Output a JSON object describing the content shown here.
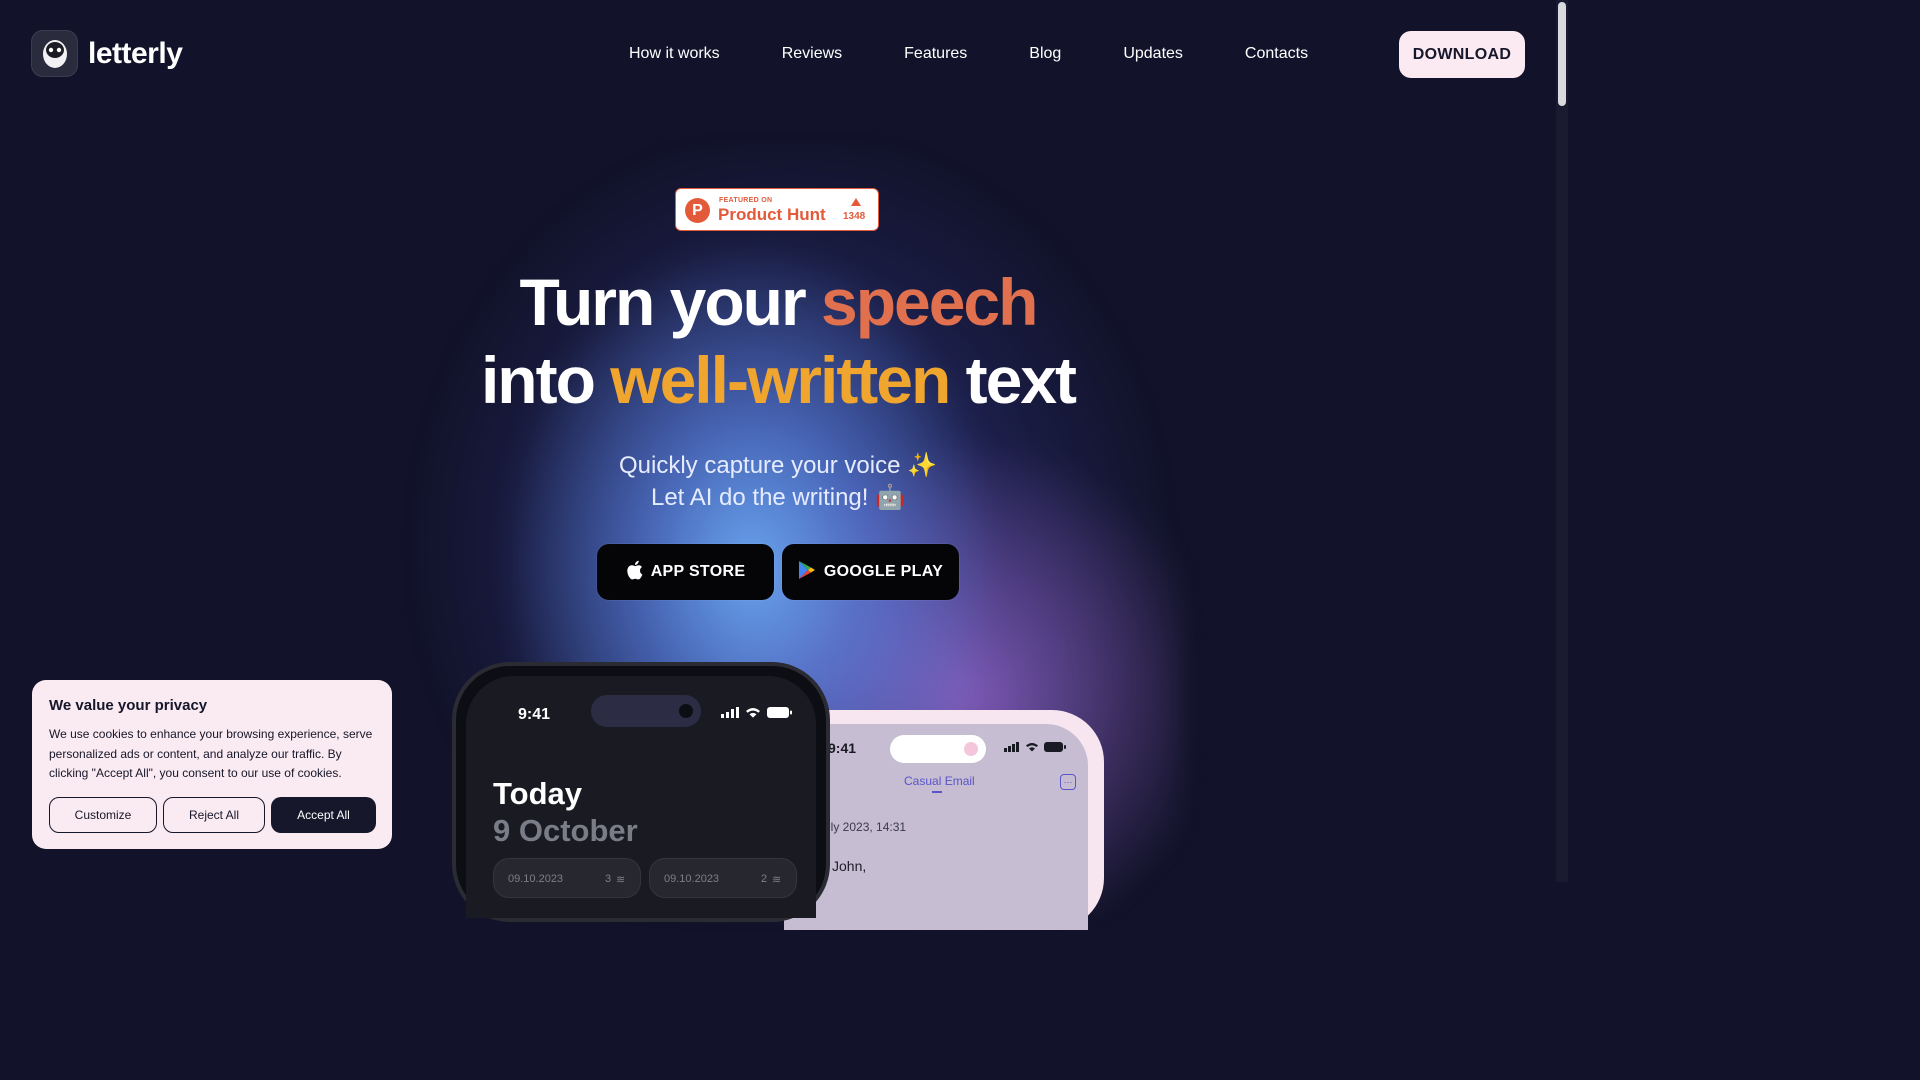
{
  "header": {
    "logo_text": "letterly",
    "nav": [
      "How it works",
      "Reviews",
      "Features",
      "Blog",
      "Updates",
      "Contacts"
    ],
    "download_label": "DOWNLOAD"
  },
  "product_hunt": {
    "featured": "FEATURED ON",
    "name": "Product Hunt",
    "votes": "1348"
  },
  "hero": {
    "line1_a": "Turn your ",
    "line1_b": "speech",
    "line2_a": "into ",
    "line2_b": "well-written",
    "line2_c": " text",
    "sub1": "Quickly capture your voice ✨",
    "sub2": "Let AI do the writing! 🤖",
    "appstore_label": "APP STORE",
    "gplay_label": "GOOGLE PLAY"
  },
  "phone_dark": {
    "time": "9:41",
    "title": "Today",
    "date": "9 October",
    "cards": [
      {
        "date": "09.10.2023",
        "count": "3"
      },
      {
        "date": "09.10.2023",
        "count": "2"
      }
    ]
  },
  "phone_light": {
    "time": "9:41",
    "tab": "Casual Email",
    "date": "uly 2023, 14:31",
    "greeting": "John,"
  },
  "cookie": {
    "title": "We value your privacy",
    "text": "We use cookies to enhance your browsing experience, serve personalized ads or content, and analyze our traffic. By clicking \"Accept All\", you consent to our use of cookies.",
    "customize": "Customize",
    "reject": "Reject All",
    "accept": "Accept All"
  },
  "colors": {
    "background": "#12132a",
    "speech": "#e0704e",
    "well_written": "#f0a52e",
    "product_hunt": "#e35a3a",
    "download_bg": "#fbeaf2"
  }
}
